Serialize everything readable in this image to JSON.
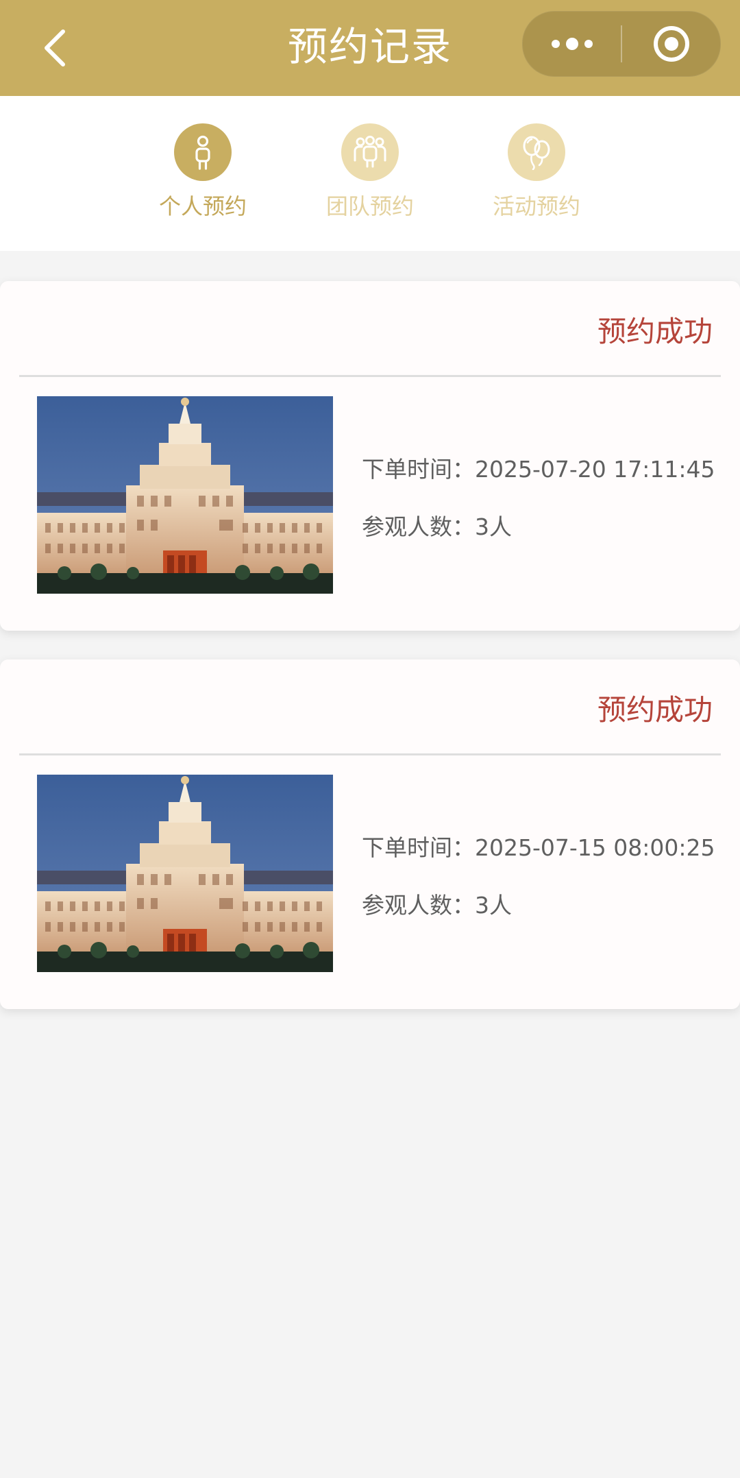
{
  "header": {
    "title": "预约记录"
  },
  "tabs": [
    {
      "label": "个人预约",
      "icon": "person-icon",
      "active": true
    },
    {
      "label": "团队预约",
      "icon": "group-icon",
      "active": false
    },
    {
      "label": "活动预约",
      "icon": "balloons-icon",
      "active": false
    }
  ],
  "records": [
    {
      "status": "预约成功",
      "order_time_label": "下单时间：",
      "order_time": "2025-07-20 17:11:45",
      "visitors_label": "参观人数：",
      "visitors": "3人"
    },
    {
      "status": "预约成功",
      "order_time_label": "下单时间：",
      "order_time": "2025-07-15 08:00:25",
      "visitors_label": "参观人数：",
      "visitors": "3人"
    }
  ],
  "colors": {
    "brand_gold": "#c8ae61",
    "status_red": "#b5443a",
    "text_gray": "#5f5f5f"
  }
}
